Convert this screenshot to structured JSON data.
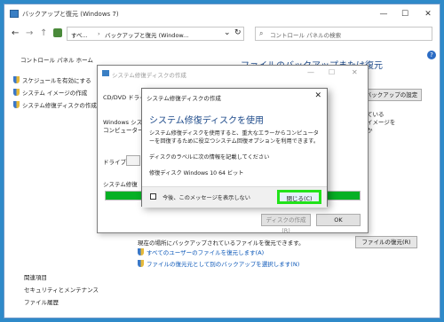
{
  "window": {
    "title": "バックアップと復元 (Windows 7)",
    "minimize": "—",
    "maximize": "☐",
    "close": "✕"
  },
  "address_bar": {
    "back": "←",
    "forward": "→",
    "up": "↑",
    "crumbs": [
      "すべ...",
      "バックアップと復元 (Window..."
    ],
    "dropdown": "⌄",
    "refresh": "↻",
    "search_placeholder": "コントロール パネルの検索"
  },
  "sidebar": {
    "home": "コントロール パネル ホーム",
    "tasks": [
      "スケジュールを有効にする",
      "システム イメージの作成",
      "システム修復ディスクの作成"
    ],
    "see_also": "関連項目",
    "links": [
      "セキュリティとメンテナンス",
      "ファイル履歴"
    ]
  },
  "main": {
    "heading": "ファイルのバックアップまたは復元",
    "help": "?",
    "setup_backup_button": "バックアップの設定",
    "partial_lines": [
      "ている",
      "イメージを",
      "か"
    ],
    "restore_description": "現在の場所にバックアップされているファイルを復元できます。",
    "restore_all_users_link": "すべてのユーザーのファイルを復元します(A)",
    "select_other_backup_link": "ファイルの復元元として別のバックアップを選択します(N)",
    "restore_files_button": "ファイルの復元(R)"
  },
  "create_disc_dialog": {
    "title": "システム修復ディスクの作成",
    "cd_label": "CD/DVD ドライブ",
    "desc_partial": [
      "Windows シス",
      "コンピューター"
    ],
    "drive_label": "ドライブ(D):",
    "status_label": "システム修復",
    "progress_percent": 100,
    "create_button": "ディスクの作成(R)",
    "ok_button": "OK",
    "progress_color": "#06b025"
  },
  "front_dialog": {
    "title": "システム修復ディスクの作成",
    "close": "✕",
    "heading": "システム修復ディスクを使用",
    "body": "システム修復ディスクを使用すると、重大なエラーからコンピューターを回復するために役立つシステム回復オプションを利用できます。",
    "label_instruction": "ディスクのラベルに次の情報を記載してください",
    "disc_label": "修復ディスク Windows 10 64 ビット",
    "dont_show_again": "今後、このメッセージを表示しない",
    "close_button": "閉じる(C)",
    "highlight_color": "#22e31a"
  }
}
